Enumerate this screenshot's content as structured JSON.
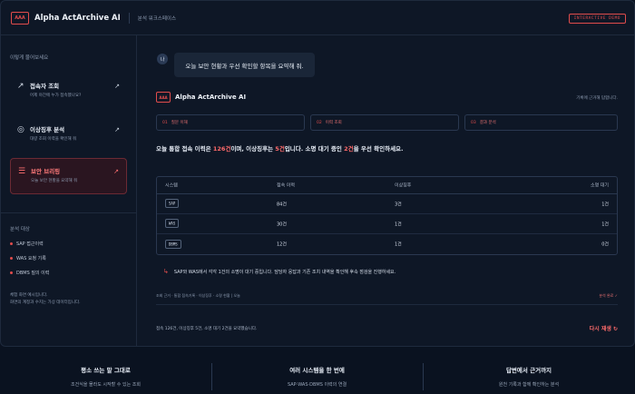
{
  "header": {
    "logo_text": "AAA",
    "app_title": "Alpha ActArchive AI",
    "workspace": "분석 워크스페이스",
    "demo_badge": "INTERACTIVE DEMO"
  },
  "sidebar": {
    "heading": "이렇게 물어보세요",
    "items": [
      {
        "title": "접속자 조회",
        "desc": "어제 야간에 누가 접속했나요?",
        "icon": "arrow-up-right-icon",
        "active": false
      },
      {
        "title": "이상징후 분석",
        "desc": "대량 조회 이력을 확인해 줘",
        "icon": "target-icon",
        "active": false
      },
      {
        "title": "보안 브리핑",
        "desc": "오늘 보안 현황을 요약해 줘",
        "icon": "list-icon",
        "active": true
      }
    ],
    "target_heading": "분석 대상",
    "targets": [
      "SAP 접근이력",
      "WAS 요청 기록",
      "DBMS 질의 이력"
    ],
    "note_line1": "체험 화면 예시입니다.",
    "note_line2": "화면의 계정과 수치는 가상 데이터입니다."
  },
  "chat": {
    "user_avatar": "나",
    "user_message": "오늘 보안 현황과 우선 확인할 항목을 요약해 줘.",
    "ai_logo": "AAA",
    "ai_name": "Alpha ActArchive AI",
    "ai_note": "기록에 근거해 답합니다.",
    "steps": [
      {
        "num": "01",
        "label": "질문 이해"
      },
      {
        "num": "02",
        "label": "이력 조회"
      },
      {
        "num": "03",
        "label": "결과 분석"
      }
    ],
    "answer": {
      "p1": "오늘 통합 접속 이력은 ",
      "v1": "126건",
      "p2": "이며, 이상징후는 ",
      "v2": "5건",
      "p3": "입니다. 소명 대기 중인 ",
      "v3": "2건",
      "p4": "을 우선 확인하세요."
    },
    "table": {
      "headers": [
        "시스템",
        "접속 이력",
        "이상징후",
        "소명 대기"
      ],
      "rows": [
        [
          "SAP",
          "84건",
          "3건",
          "1건"
        ],
        [
          "WAS",
          "30건",
          "1건",
          "1건"
        ],
        [
          "DBMS",
          "12건",
          "1건",
          "0건"
        ]
      ]
    },
    "alert": "SAP와 WAS에서 각각 1건의 소명이 대기 중입니다. 담당자 응답과 기존 조치 내역을 확인해 후속 점검을 진행하세요.",
    "meta": "조회 근거 · 통합 접속기록 · 이상징후 · 소명 현황 | 오늘",
    "meta_right": "분석 완료 ✓",
    "summary": "접속 126건, 이상징후 5건, 소명 대기 2건을 요약했습니다.",
    "rerun": "다시 재생 ↻"
  },
  "footer": {
    "features": [
      {
        "title": "평소 쓰는 말 그대로",
        "desc": "조건식을 몰라도 시작할 수 있는 조회"
      },
      {
        "title": "여러 시스템을 한 번에",
        "desc": "SAP·WAS·DBMS 이력의 연결"
      },
      {
        "title": "답변에서 근거까지",
        "desc": "원천 기록과 함께 확인하는 분석"
      }
    ]
  },
  "colors": {
    "accent": "#e14c4c",
    "background": "#0e1726",
    "highlight": "#ff6b6b"
  }
}
